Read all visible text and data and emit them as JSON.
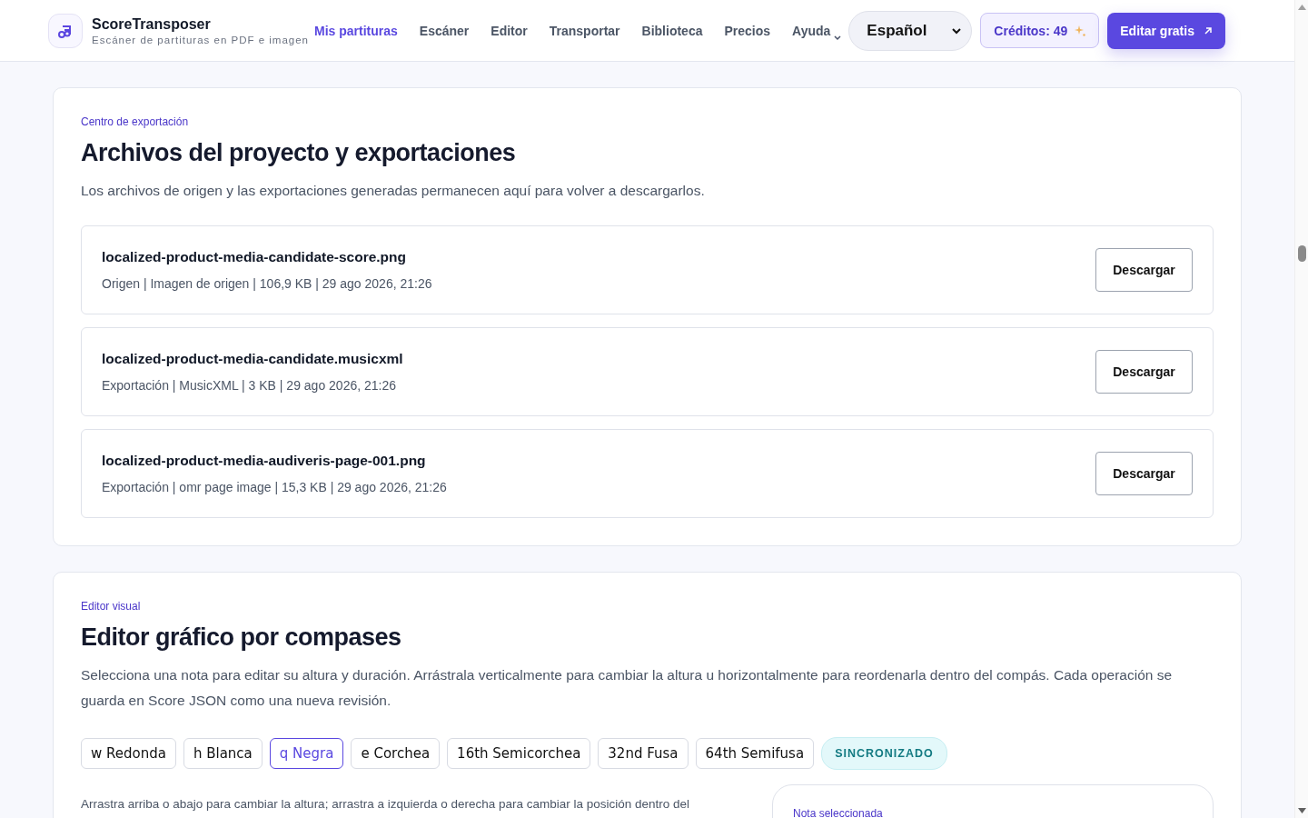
{
  "header": {
    "brand": "ScoreTransposer",
    "tagline": "Escáner de partituras en PDF e imagen",
    "nav": [
      {
        "label": "Mis partituras",
        "selected": true,
        "kind": "link"
      },
      {
        "label": "Escáner",
        "selected": false,
        "kind": "link"
      },
      {
        "label": "Editor",
        "selected": false,
        "kind": "link"
      },
      {
        "label": "Transportar",
        "selected": false,
        "kind": "link"
      },
      {
        "label": "Biblioteca",
        "selected": false,
        "kind": "link"
      },
      {
        "label": "Precios",
        "selected": false,
        "kind": "link"
      },
      {
        "label": "Ayuda",
        "selected": false,
        "kind": "menu"
      }
    ],
    "language": "Español",
    "credits": "Créditos: 49",
    "cta": "Editar gratis"
  },
  "export_section": {
    "eyebrow": "Centro de exportación",
    "title": "Archivos del proyecto y exportaciones",
    "description": "Los archivos de origen y las exportaciones generadas permanecen aquí para volver a descargarlos.",
    "files": [
      {
        "name": "localized-product-media-candidate-score.png",
        "meta": "Origen | Imagen de origen | 106,9 KB | 29 ago 2026, 21:26",
        "action": "Descargar"
      },
      {
        "name": "localized-product-media-candidate.musicxml",
        "meta": "Exportación | MusicXML | 3 KB | 29 ago 2026, 21:26",
        "action": "Descargar"
      },
      {
        "name": "localized-product-media-audiveris-page-001.png",
        "meta": "Exportación | omr page image | 15,3 KB | 29 ago 2026, 21:26",
        "action": "Descargar"
      }
    ]
  },
  "editor_section": {
    "eyebrow": "Editor visual",
    "title": "Editor gráfico por compases",
    "description": "Selecciona una nota para editar su altura y duración. Arrástrala verticalmente para cambiar la altura u horizontalmente para reordenarla dentro del compás. Cada operación se guarda en Score JSON como una nueva revisión.",
    "durations": [
      {
        "label": "w Redonda",
        "selected": false
      },
      {
        "label": "h Blanca",
        "selected": false
      },
      {
        "label": "q Negra",
        "selected": true
      },
      {
        "label": "e Corchea",
        "selected": false
      },
      {
        "label": "16th Semicorchea",
        "selected": false
      },
      {
        "label": "32nd Fusa",
        "selected": false
      },
      {
        "label": "64th Semifusa",
        "selected": false
      }
    ],
    "status": "SINCRONIZADO",
    "hint": "Arrastra arriba o abajo para cambiar la altura; arrastra a izquierda o derecha para cambiar la posición dentro del",
    "panel_title": "Nota seleccionada"
  }
}
